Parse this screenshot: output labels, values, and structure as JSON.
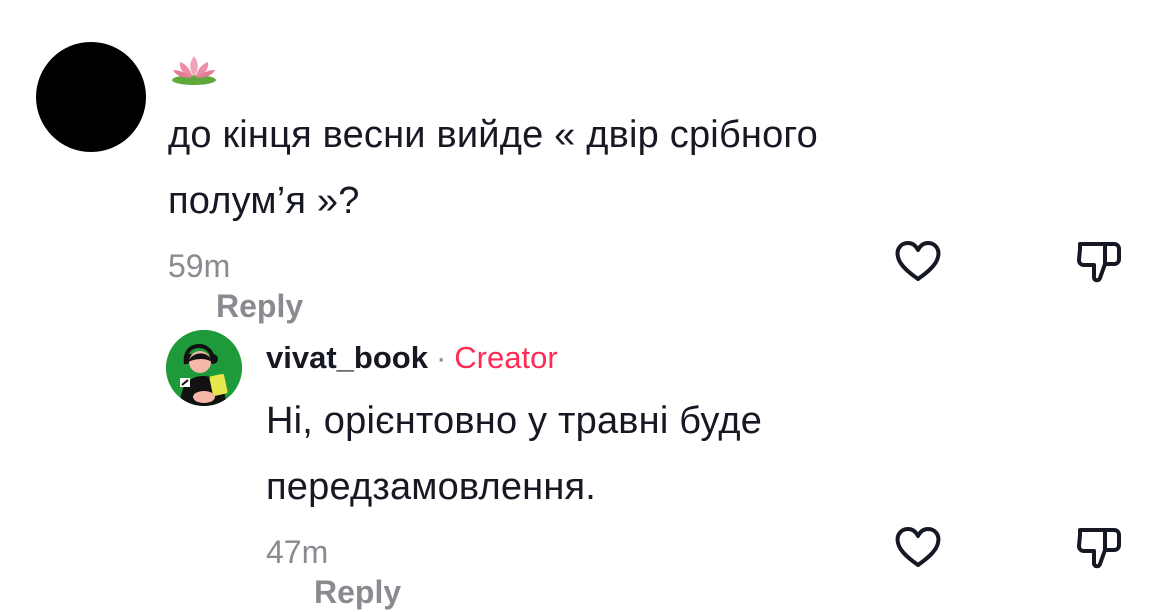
{
  "comments": [
    {
      "avatar_icon": "black-avatar",
      "username_icon": "lotus-emoji-icon",
      "text_lines": [
        "до кінця весни вийде « двір срібного",
        "полум’я »?"
      ],
      "time": "59m",
      "reply_label": "Reply"
    },
    {
      "avatar_icon": "cartoon-reader-avatar",
      "username": "vivat_book",
      "separator": "·",
      "badge": "Creator",
      "text_lines": [
        "Ні, орієнтовно у травні буде",
        "передзамовлення."
      ],
      "time": "47m",
      "reply_label": "Reply"
    }
  ],
  "icons": {
    "like": "heart-outline-icon",
    "dislike": "thumbs-down-outline-icon"
  },
  "colors": {
    "text": "#161823",
    "muted": "#8a8b91",
    "creator_badge": "#fe2c55",
    "avatar_green": "#1f9a3a"
  }
}
